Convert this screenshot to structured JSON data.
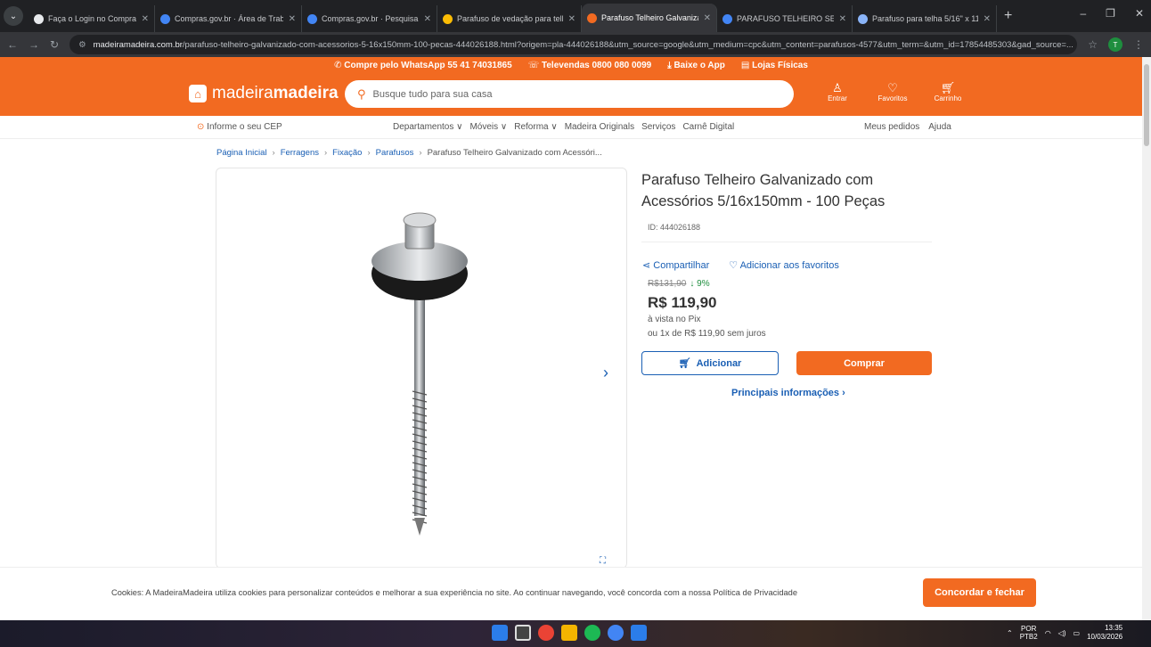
{
  "browser": {
    "tabs": [
      {
        "title": "Faça o Login no Comprasgov.br",
        "color": "#e8eaed"
      },
      {
        "title": "Compras.gov.br · Área de Trab.",
        "color": "#4285f4"
      },
      {
        "title": "Compras.gov.br · Pesquisa de P",
        "color": "#4285f4"
      },
      {
        "title": "Parafuso de vedação para telha",
        "color": "#fbbc04"
      },
      {
        "title": "Parafuso Telheiro Galvanizado",
        "color": "#f26a21",
        "active": true
      },
      {
        "title": "PARAFUSO TELHEIRO SEXTAVA",
        "color": "#4285f4"
      },
      {
        "title": "Parafuso para telha 5/16\" x 11",
        "color": "#8ab4f8"
      }
    ],
    "url_domain": "madeiramadeira.com.br",
    "url_path": "/parafuso-telheiro-galvanizado-com-acessorios-5-16x150mm-100-pecas-444026188.html?origem=pla-444026188&utm_source=google&utm_medium=cpc&utm_content=parafusos-4577&utm_term=&utm_id=17854485303&gad_source=...",
    "profile_initial": "T",
    "new_tab": "+"
  },
  "topstrip": {
    "whatsapp": "Compre pelo WhatsApp 55 41 74031865",
    "televendas": "Televendas 0800 080 0099",
    "app": "Baixe o App",
    "lojas": "Lojas Físicas"
  },
  "header": {
    "logo_light": "madeira",
    "logo_bold": "madeira",
    "search_placeholder": "Busque tudo para sua casa",
    "entrar": "Entrar",
    "favoritos": "Favoritos",
    "carrinho": "Carrinho"
  },
  "catnav": {
    "cep": "Informe o seu CEP",
    "menu": [
      "Departamentos ∨",
      "Móveis ∨",
      "Reforma ∨",
      "Madeira Originals",
      "Serviços",
      "Carnê Digital"
    ],
    "meus_pedidos": "Meus pedidos",
    "ajuda": "Ajuda"
  },
  "breadcrumb": {
    "items": [
      "Página Inicial",
      "Ferragens",
      "Fixação",
      "Parafusos"
    ],
    "current": "Parafuso Telheiro Galvanizado com Acessóri..."
  },
  "product": {
    "title": "Parafuso Telheiro Galvanizado com Acessórios 5/16x150mm - 100 Peças",
    "id": "ID: 444026188",
    "share": "Compartilhar",
    "favorite": "Adicionar aos favoritos",
    "old_price": "R$131,90",
    "discount": "↓ 9%",
    "price": "R$ 119,90",
    "pix": "à vista no Pix",
    "installments": "ou 1x de R$ 119,90 sem juros",
    "add_button": "Adicionar",
    "buy_button": "Comprar",
    "main_info": "Principais informações ›"
  },
  "cookie": {
    "text": "Cookies: A MadeiraMadeira utiliza cookies para personalizar conteúdos e melhorar a sua experiência no site. Ao continuar navegando, você concorda com a nossa Política de Privacidade",
    "button": "Concordar e fechar"
  },
  "taskbar": {
    "lang": "POR",
    "lang2": "PTB2",
    "time": "13:35",
    "date": "10/03/2026"
  },
  "colors": {
    "brand": "#f26a21",
    "link": "#1a5fb4"
  }
}
